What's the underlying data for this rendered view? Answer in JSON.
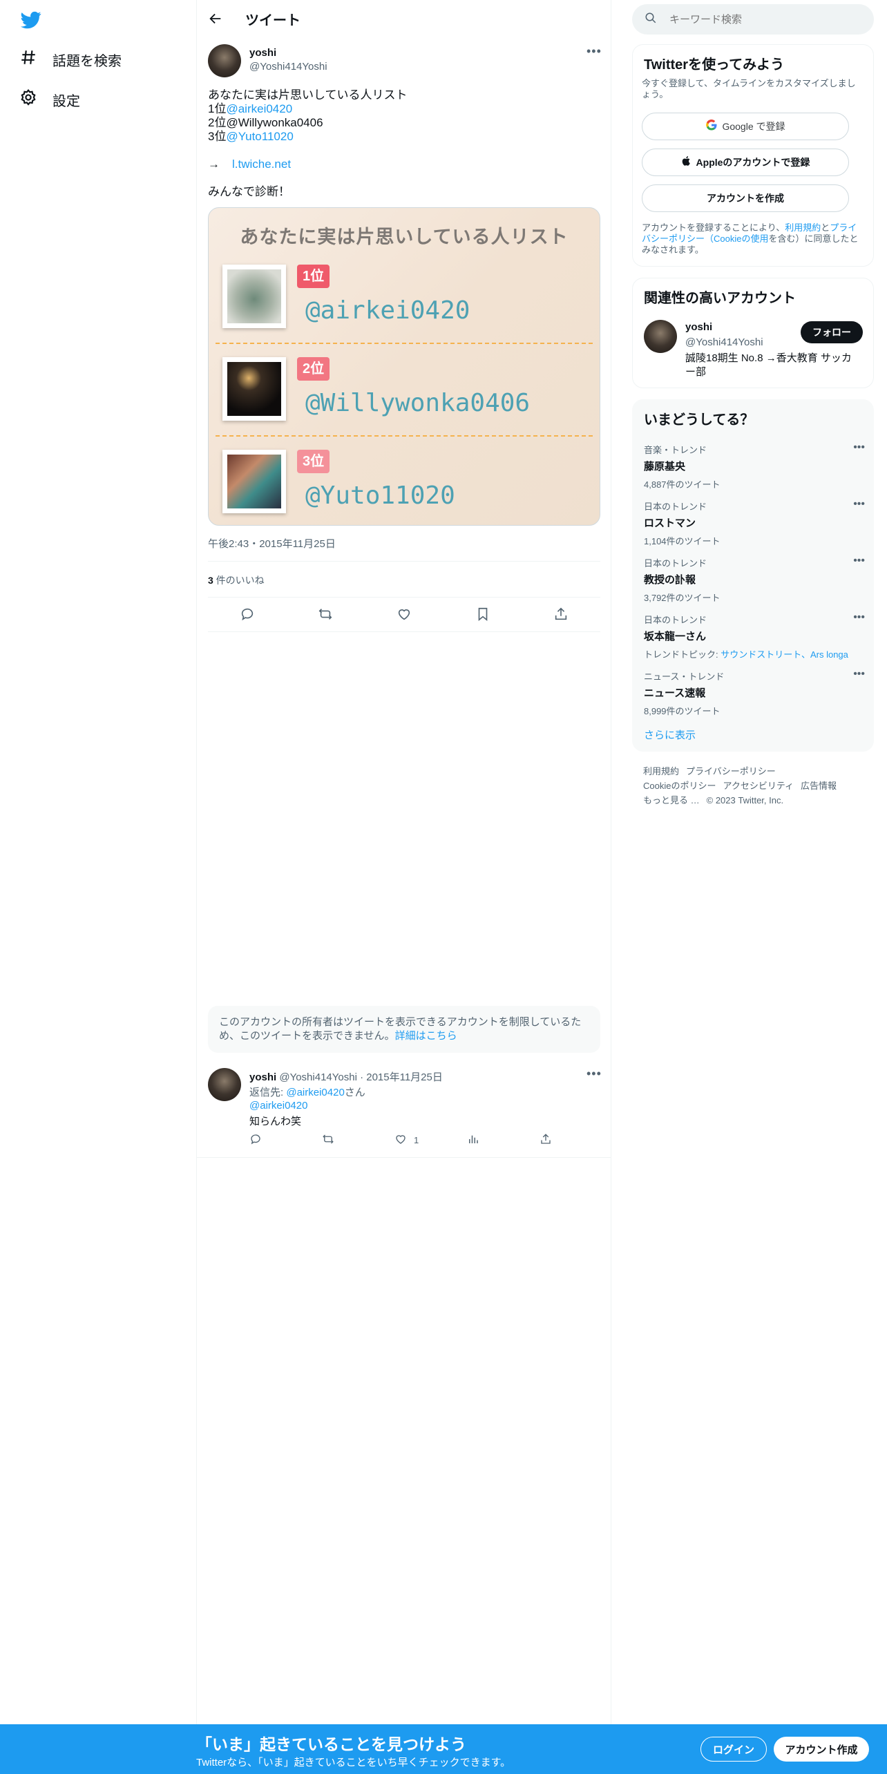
{
  "nav": {
    "items": [
      {
        "label": "話題を検索",
        "icon": "hashtag-icon"
      },
      {
        "label": "設定",
        "icon": "gear-icon"
      }
    ]
  },
  "header": {
    "title": "ツイート"
  },
  "tweet": {
    "author_name": "yoshi",
    "author_handle": "@Yoshi414Yoshi",
    "line1": "あなたに実は片思いしている人リスト",
    "line2_prefix": "1位",
    "line2_link": "@airkei0420",
    "line3": "2位@Willywonka0406",
    "line4_prefix": "3位",
    "line4_link": "@Yuto11020",
    "arrow": "→",
    "url": "l.twiche.net",
    "closing": "みんなで診断！",
    "card": {
      "title": "あなたに実は片思いしている人リスト",
      "ranks": [
        {
          "badge": "1位",
          "name": "@airkei0420",
          "color": "#ef5a6a"
        },
        {
          "badge": "2位",
          "name": "@Willywonka0406",
          "color": "#f27682"
        },
        {
          "badge": "3位",
          "name": "@Yuto11020",
          "color": "#f4919a"
        }
      ]
    },
    "timestamp": "午後2:43・2015年11月25日",
    "likes_count": "3",
    "likes_label": " 件のいいね"
  },
  "notice": {
    "text": "このアカウントの所有者はツイートを表示できるアカウントを制限しているため、このツイートを表示できません。",
    "link": "詳細はこちら"
  },
  "reply": {
    "name": "yoshi",
    "meta": " @Yoshi414Yoshi · 2015年11月25日",
    "reply_to_label": "返信先: ",
    "reply_to_link": "@airkei0420",
    "reply_to_suffix": "さん",
    "mention": "@airkei0420",
    "text": "知らんわ笑",
    "like_count": "1"
  },
  "search": {
    "placeholder": "キーワード検索"
  },
  "signup_panel": {
    "title": "Twitterを使ってみよう",
    "subtitle": "今すぐ登録して、タイムラインをカスタマイズしましょう。",
    "google_label": "Google で登録",
    "apple_label": "Appleのアカウントで登録",
    "create_label": "アカウントを作成",
    "terms_prefix": "アカウントを登録することにより、",
    "terms_link1": "利用規約",
    "terms_and": "と",
    "terms_link2": "プライバシーポリシー（Cookieの使用",
    "terms_suffix": "を含む）に同意したとみなされます。"
  },
  "related": {
    "title": "関連性の高いアカウント",
    "name": "yoshi",
    "handle": "@Yoshi414Yoshi",
    "bio": "誠陵18期生 No.8 →香大教育 サッカー部",
    "follow_label": "フォロー"
  },
  "trends": {
    "title": "いまどうしてる？",
    "items": [
      {
        "category": "音楽・トレンド",
        "title": "藤原基央",
        "count": "4,887件のツイート"
      },
      {
        "category": "日本のトレンド",
        "title": "ロストマン",
        "count": "1,104件のツイート"
      },
      {
        "category": "日本のトレンド",
        "title": "教授の訃報",
        "count": "3,792件のツイート"
      },
      {
        "category": "日本のトレンド",
        "title": "坂本龍一さん",
        "count_prefix": "トレンドトピック: ",
        "count_link": "サウンドストリート、Ars longa"
      },
      {
        "category": "ニュース・トレンド",
        "title": "ニュース速報",
        "count": "8,999件のツイート"
      }
    ],
    "show_more": "さらに表示"
  },
  "footer": {
    "links": [
      "利用規約",
      "プライバシーポリシー",
      "Cookieのポリシー",
      "アクセシビリティ",
      "広告情報",
      "もっと見る …",
      "© 2023 Twitter, Inc."
    ]
  },
  "bottom_bar": {
    "title": "「いま」起きていることを見つけよう",
    "subtitle": "Twitterなら、「いま」起きていることをいち早くチェックできます。",
    "login_label": "ログイン",
    "signup_label": "アカウント作成"
  },
  "colors": {
    "brand": "#1d9bf0",
    "text": "#0f1419",
    "secondary_text": "#536471"
  }
}
